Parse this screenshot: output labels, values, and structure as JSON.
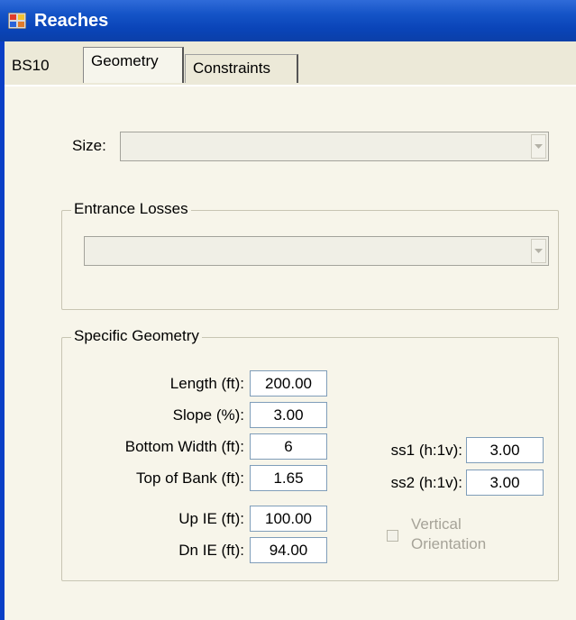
{
  "window": {
    "title": "Reaches"
  },
  "tabs": [
    {
      "label": "BS10",
      "selected": false
    },
    {
      "label": "Geometry",
      "selected": true
    },
    {
      "label": "Constraints",
      "selected": false
    }
  ],
  "size": {
    "label": "Size:",
    "value": ""
  },
  "entrance_losses": {
    "caption": "Entrance Losses",
    "value": ""
  },
  "specific_geometry": {
    "caption": "Specific Geometry",
    "length": {
      "label": "Length (ft):",
      "value": "200.00"
    },
    "slope": {
      "label": "Slope (%):",
      "value": "3.00"
    },
    "bottom_width": {
      "label": "Bottom Width (ft):",
      "value": "6"
    },
    "top_of_bank": {
      "label": "Top of Bank (ft):",
      "value": "1.65"
    },
    "up_ie": {
      "label": "Up IE  (ft):",
      "value": "100.00"
    },
    "dn_ie": {
      "label": "Dn IE  (ft):",
      "value": "94.00"
    },
    "ss1": {
      "label": "ss1 (h:1v):",
      "value": "3.00"
    },
    "ss2": {
      "label": "ss2 (h:1v):",
      "value": "3.00"
    },
    "vertical_orientation": {
      "label_line1": "Vertical",
      "label_line2": "Orientation",
      "checked": false,
      "enabled": false
    }
  },
  "colors": {
    "titlebar": "#0a44b8",
    "background": "#f7f5ea",
    "disabled_text": "#a6a398"
  }
}
